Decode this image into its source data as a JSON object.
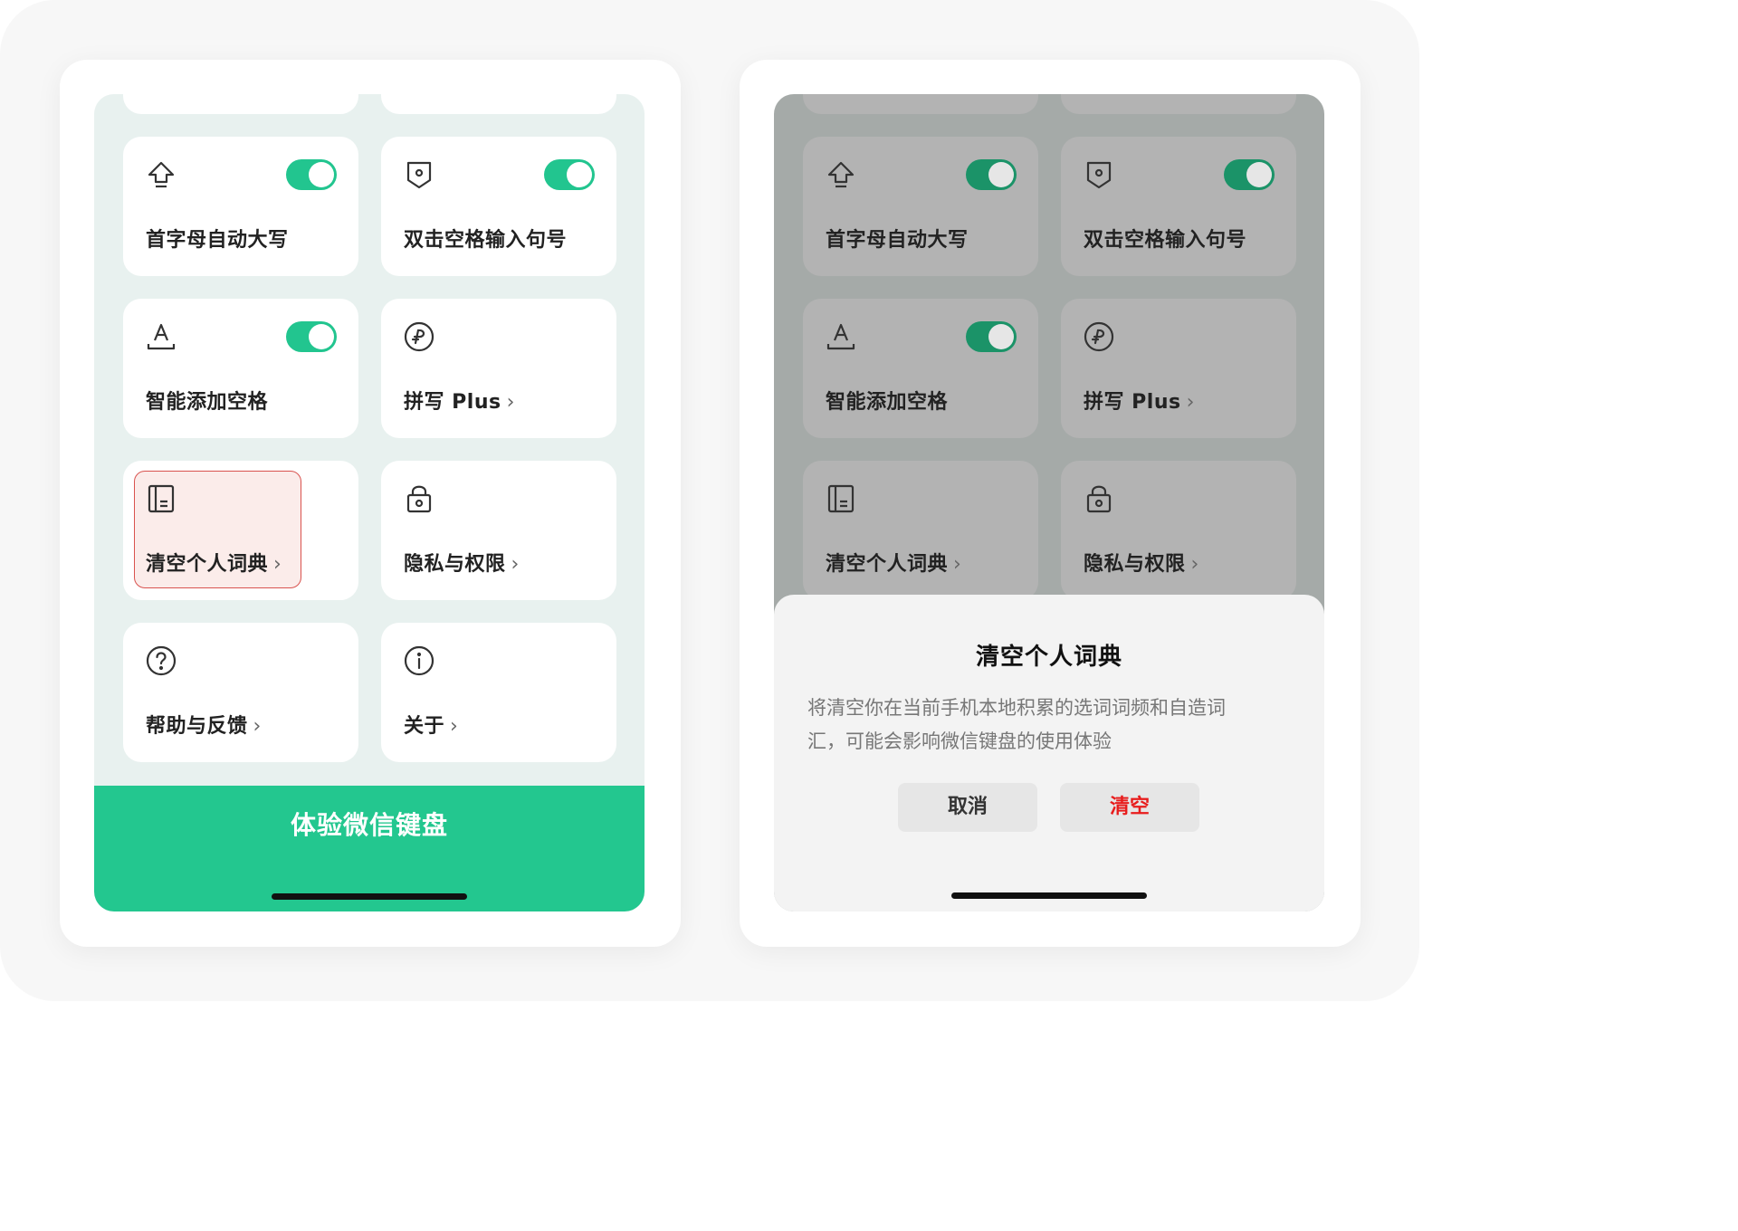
{
  "colors": {
    "accent_green": "#23c78f",
    "toggle_dimmed": "#1b9368",
    "danger_red": "#e81c1c",
    "highlight_border": "#d9534f"
  },
  "left_screen": {
    "cards": [
      {
        "label": "首字母自动大写",
        "icon": "shift-arrow-icon",
        "toggle_on": true
      },
      {
        "label": "双击空格输入句号",
        "icon": "period-badge-icon",
        "toggle_on": true
      },
      {
        "label": "智能添加空格",
        "icon": "text-space-icon",
        "toggle_on": true
      },
      {
        "label": "拼写 Plus",
        "icon": "spell-plus-icon",
        "chevron": "›"
      },
      {
        "label": "清空个人词典",
        "icon": "dictionary-icon",
        "chevron": "›",
        "highlighted": true
      },
      {
        "label": "隐私与权限",
        "icon": "lock-icon",
        "chevron": "›"
      },
      {
        "label": "帮助与反馈",
        "icon": "question-circle-icon",
        "chevron": "›"
      },
      {
        "label": "关于",
        "icon": "info-circle-icon",
        "chevron": "›"
      }
    ],
    "cta_label": "体验微信键盘"
  },
  "right_screen": {
    "cards": [
      {
        "label": "首字母自动大写",
        "icon": "shift-arrow-icon",
        "toggle_on": true
      },
      {
        "label": "双击空格输入句号",
        "icon": "period-badge-icon",
        "toggle_on": true
      },
      {
        "label": "智能添加空格",
        "icon": "text-space-icon",
        "toggle_on": true
      },
      {
        "label": "拼写 Plus",
        "icon": "spell-plus-icon",
        "chevron": "›"
      },
      {
        "label": "清空个人词典",
        "icon": "dictionary-icon",
        "chevron": "›"
      },
      {
        "label": "隐私与权限",
        "icon": "lock-icon",
        "chevron": "›"
      }
    ],
    "dialog": {
      "title": "清空个人词典",
      "body_line1": "将清空你在当前手机本地积累的选词词频和自造词",
      "body_line2": "汇，可能会影响微信键盘的使用体验",
      "cancel_label": "取消",
      "confirm_label": "清空"
    }
  }
}
